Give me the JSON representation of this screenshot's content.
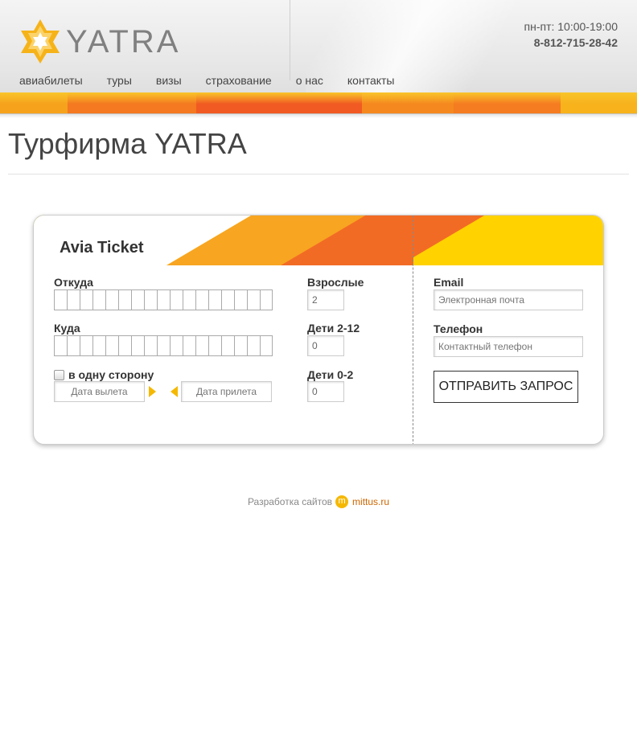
{
  "header": {
    "logo_text": "YATRA",
    "hours": "пн-пт: 10:00-19:00",
    "phone": "8-812-715-28-42",
    "nav": [
      "авиабилеты",
      "туры",
      "визы",
      "страхование",
      "о нас",
      "контакты"
    ],
    "stripe_colors": [
      "#f6a21d",
      "#f47920",
      "#f15a22",
      "#f5891f",
      "#f57c21",
      "#f7b21c"
    ]
  },
  "page_title": "Турфирма YATRA",
  "ticket": {
    "title": "Avia Ticket",
    "from_label": "Откуда",
    "to_label": "Куда",
    "one_way_label": "в одну сторону",
    "departure_placeholder": "Дата вылета",
    "arrival_placeholder": "Дата прилета",
    "adults_label": "Взрослые",
    "adults_value": "2",
    "children_label": "Дети 2-12",
    "children_value": "0",
    "infants_label": "Дети 0-2",
    "infants_value": "0",
    "email_label": "Email",
    "email_placeholder": "Электронная почта",
    "phone_label": "Телефон",
    "phone_placeholder": "Контактный телефон",
    "submit_label": "ОТПРАВИТЬ ЗАПРОС"
  },
  "footer": {
    "text": "Разработка сайтов",
    "link": "mittus.ru",
    "icon_letter": "m"
  }
}
